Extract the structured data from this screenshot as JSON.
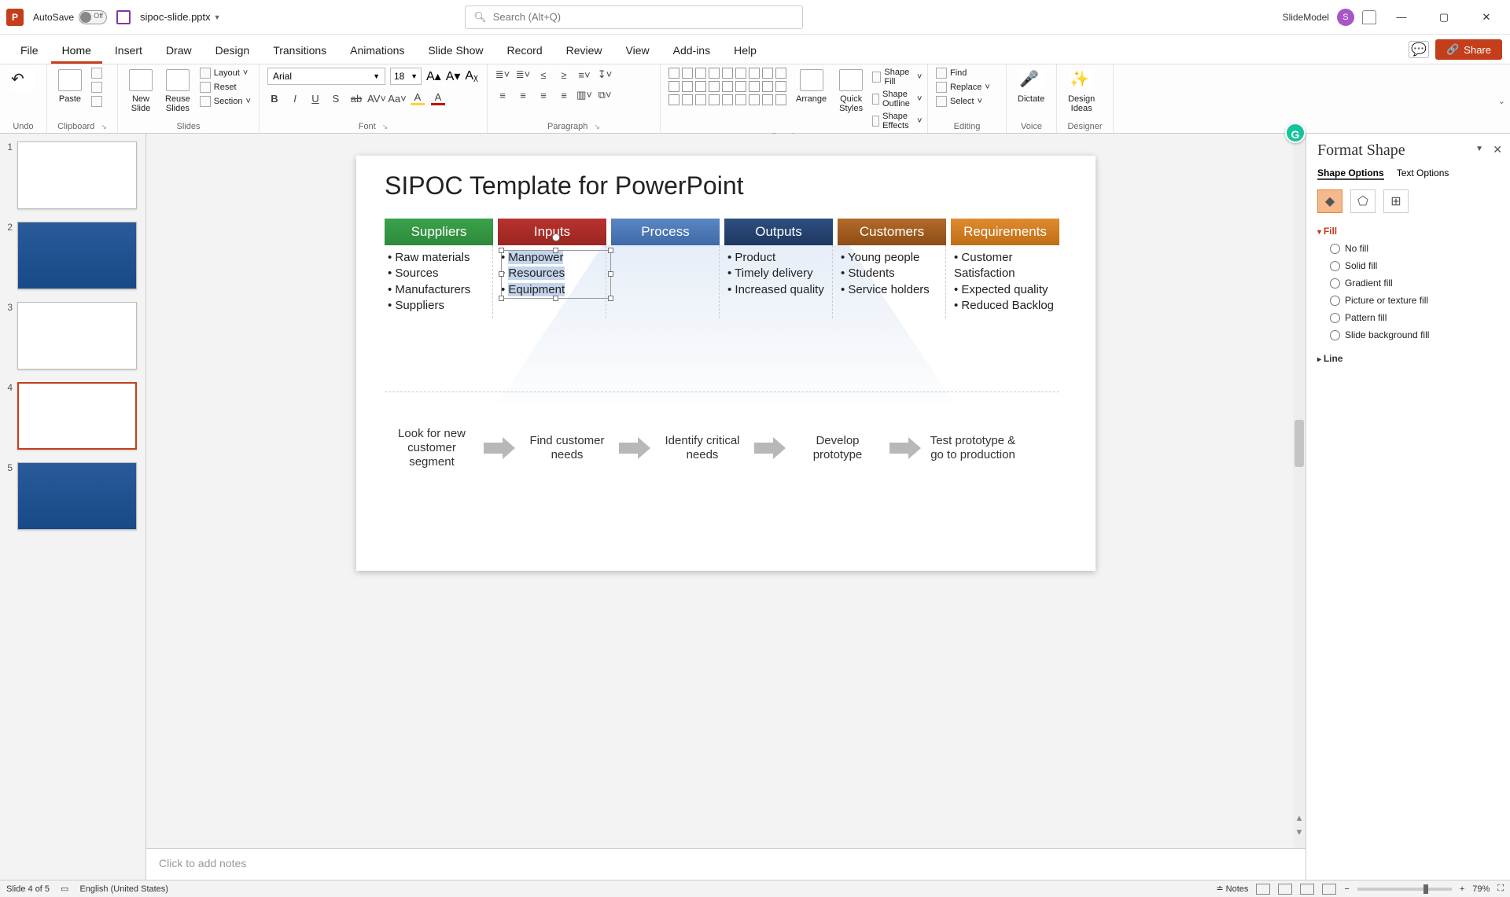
{
  "app": {
    "icon_letter": "P",
    "autosave_label": "AutoSave",
    "autosave_state": "Off",
    "filename": "sipoc-slide.pptx"
  },
  "search": {
    "placeholder": "Search (Alt+Q)"
  },
  "user": {
    "name": "SlideModel",
    "initial": "S"
  },
  "window": {
    "minimize": "—",
    "restore": "▢",
    "close": "✕"
  },
  "tabs": {
    "file": "File",
    "home": "Home",
    "insert": "Insert",
    "draw": "Draw",
    "design": "Design",
    "transitions": "Transitions",
    "animations": "Animations",
    "slideshow": "Slide Show",
    "record": "Record",
    "review": "Review",
    "view": "View",
    "addins": "Add-ins",
    "help": "Help"
  },
  "ribbon_right": {
    "share": "Share"
  },
  "ribbon": {
    "undo": "Undo",
    "clipboard": {
      "paste": "Paste",
      "group": "Clipboard"
    },
    "slides": {
      "new": "New\nSlide",
      "reuse": "Reuse\nSlides",
      "layout": "Layout",
      "reset": "Reset",
      "section": "Section",
      "group": "Slides"
    },
    "font": {
      "family": "Arial",
      "size": "18",
      "group": "Font"
    },
    "paragraph": {
      "group": "Paragraph"
    },
    "drawing": {
      "arrange": "Arrange",
      "quick": "Quick\nStyles",
      "fill": "Shape Fill",
      "outline": "Shape Outline",
      "effects": "Shape Effects",
      "group": "Drawing"
    },
    "editing": {
      "find": "Find",
      "replace": "Replace",
      "select": "Select",
      "group": "Editing"
    },
    "voice": {
      "dictate": "Dictate",
      "group": "Voice"
    },
    "designer": {
      "ideas": "Design\nIdeas",
      "group": "Designer"
    }
  },
  "thumbs": [
    "1",
    "2",
    "3",
    "4",
    "5"
  ],
  "slide": {
    "title": "SIPOC Template for PowerPoint",
    "headers": {
      "suppliers": "Suppliers",
      "inputs": "Inputs",
      "process": "Process",
      "outputs": "Outputs",
      "customers": "Customers",
      "requirements": "Requirements"
    },
    "cols": {
      "suppliers": [
        "Raw materials",
        "Sources",
        "Manufacturers",
        "Suppliers"
      ],
      "inputs": [
        "Manpower",
        "Resources",
        "Equipment"
      ],
      "process": [],
      "outputs": [
        "Product",
        "Timely delivery",
        "Increased quality"
      ],
      "customers": [
        "Young people",
        "Students",
        "Service holders"
      ],
      "requirements": [
        "Customer Satisfaction",
        "Expected quality",
        "Reduced Backlog"
      ]
    },
    "flow": [
      "Look for new customer segment",
      "Find customer needs",
      "Identify critical needs",
      "Develop prototype",
      "Test prototype & go to production"
    ]
  },
  "notes_placeholder": "Click to add notes",
  "format_pane": {
    "title": "Format Shape",
    "tabs": {
      "shape": "Shape Options",
      "text": "Text Options"
    },
    "section_fill": "Fill",
    "opts": {
      "none": "No fill",
      "solid": "Solid fill",
      "gradient": "Gradient fill",
      "picture": "Picture or texture fill",
      "pattern": "Pattern fill",
      "slidebg": "Slide background fill"
    },
    "section_line": "Line"
  },
  "status": {
    "slide": "Slide 4 of 5",
    "lang": "English (United States)",
    "notes": "Notes",
    "zoom": "79%"
  }
}
